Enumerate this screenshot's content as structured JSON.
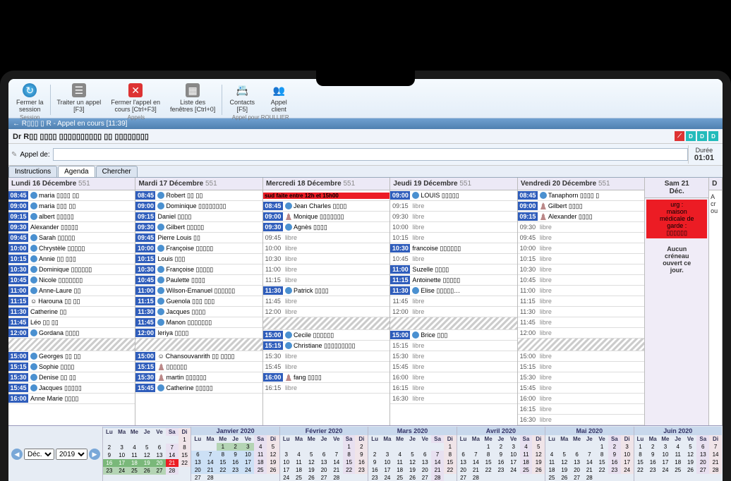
{
  "ribbon": {
    "close_session": "Fermer la\nsession",
    "session_group": "Session",
    "handle_call": "Traiter un appel\n[F3]",
    "close_call": "Fermer l'appel en\ncours [Ctrl+F3]",
    "window_list": "Liste des\nfenêtres [Ctrl+0]",
    "calls_group": "Appels",
    "contacts": "Contacts\n[F5]",
    "client_call": "Appel\nclient",
    "client_group": "Appel pour ROULLIER"
  },
  "titlebar": "← R▯▯▯ ▯ R - Appel en cours [11:39]",
  "context_name": "Dr R▯▯ ▯▯▯▯ ▯▯▯▯▯▯▯▯▯▯ ▯▯ ▯▯▯▯▯▯▯▯",
  "search": {
    "label": "Appel de:",
    "placeholder": ""
  },
  "duree": {
    "label": "Durée",
    "value": "01:01"
  },
  "tabs": {
    "instructions": "Instructions",
    "agenda": "Agenda",
    "chercher": "Chercher"
  },
  "days": [
    {
      "title": "Lundi 16 Décembre",
      "count": "551",
      "slots": [
        {
          "time": "08:45",
          "kind": "appt",
          "icon": "globe",
          "label": "maria ▯▯▯▯ ▯▯"
        },
        {
          "time": "09:00",
          "kind": "appt",
          "icon": "globe",
          "label": "maria ▯▯▯ ▯▯"
        },
        {
          "time": "09:15",
          "kind": "appt",
          "icon": "globe",
          "label": "albert ▯▯▯▯▯"
        },
        {
          "time": "09:30",
          "kind": "appt",
          "icon": "",
          "label": "Alexander ▯▯▯▯▯"
        },
        {
          "time": "09:45",
          "kind": "appt",
          "icon": "globe",
          "label": "Sarah ▯▯▯▯▯"
        },
        {
          "time": "10:00",
          "kind": "appt",
          "icon": "globe",
          "label": "Chrystèle ▯▯▯▯▯"
        },
        {
          "time": "10:15",
          "kind": "appt",
          "icon": "globe",
          "label": "Annie ▯▯ ▯▯▯"
        },
        {
          "time": "10:30",
          "kind": "appt",
          "icon": "globe",
          "label": "Dominique ▯▯▯▯▯▯"
        },
        {
          "time": "10:45",
          "kind": "appt",
          "icon": "globe",
          "label": "Nicole ▯▯▯▯▯▯▯"
        },
        {
          "time": "11:00",
          "kind": "appt",
          "icon": "globe",
          "label": "Anne-Laure ▯▯"
        },
        {
          "time": "11:15",
          "kind": "appt",
          "icon": "emoji",
          "label": "Harouna ▯▯ ▯▯"
        },
        {
          "time": "11:30",
          "kind": "appt",
          "icon": "",
          "label": "Catherine ▯▯"
        },
        {
          "time": "11:45",
          "kind": "appt",
          "icon": "",
          "label": "Léo ▯▯ ▯▯"
        },
        {
          "time": "12:00",
          "kind": "appt",
          "icon": "globe",
          "label": "Gordana ▯▯▯▯"
        }
      ],
      "afternoon": [
        {
          "time": "15:00",
          "kind": "appt",
          "icon": "globe",
          "label": "Georges ▯▯ ▯▯"
        },
        {
          "time": "15:15",
          "kind": "appt",
          "icon": "globe",
          "label": "Sophie ▯▯▯▯"
        },
        {
          "time": "15:30",
          "kind": "appt",
          "icon": "globe",
          "label": "Denise ▯▯ ▯▯"
        },
        {
          "time": "15:45",
          "kind": "appt",
          "icon": "globe",
          "label": "Jacques ▯▯▯▯▯"
        },
        {
          "time": "16:00",
          "kind": "appt",
          "icon": "",
          "label": "Anne Marie ▯▯▯▯"
        }
      ]
    },
    {
      "title": "Mardi 17 Décembre",
      "count": "551",
      "slots": [
        {
          "time": "08:45",
          "kind": "appt",
          "icon": "globe",
          "label": "Robert ▯▯ ▯▯"
        },
        {
          "time": "09:00",
          "kind": "appt",
          "icon": "globe",
          "label": "Dominique ▯▯▯▯▯▯▯▯"
        },
        {
          "time": "09:15",
          "kind": "appt",
          "icon": "",
          "label": "Daniel ▯▯▯▯"
        },
        {
          "time": "09:30",
          "kind": "appt",
          "icon": "globe",
          "label": "Gilbert ▯▯▯▯▯"
        },
        {
          "time": "09:45",
          "kind": "appt",
          "icon": "",
          "label": "Pierre Louis ▯▯"
        },
        {
          "time": "10:00",
          "kind": "appt",
          "icon": "globe",
          "label": "Françoise ▯▯▯▯▯"
        },
        {
          "time": "10:15",
          "kind": "appt",
          "icon": "",
          "label": "Louis ▯▯▯"
        },
        {
          "time": "10:30",
          "kind": "appt",
          "icon": "globe",
          "label": "Françoise ▯▯▯▯▯"
        },
        {
          "time": "10:45",
          "kind": "appt",
          "icon": "globe",
          "label": "Paulette ▯▯▯▯"
        },
        {
          "time": "11:00",
          "kind": "appt",
          "icon": "globe",
          "label": "Wilson-Emanuel ▯▯▯▯▯▯"
        },
        {
          "time": "11:15",
          "kind": "appt",
          "icon": "globe",
          "label": "Guenola ▯▯▯ ▯▯▯"
        },
        {
          "time": "11:30",
          "kind": "appt",
          "icon": "globe",
          "label": "Jacques ▯▯▯▯"
        },
        {
          "time": "11:45",
          "kind": "appt",
          "icon": "globe",
          "label": "Manon ▯▯▯▯▯▯▯"
        },
        {
          "time": "12:00",
          "kind": "appt",
          "icon": "",
          "label": "leriya ▯▯▯▯"
        }
      ],
      "afternoon": [
        {
          "time": "15:00",
          "kind": "appt",
          "icon": "emoji",
          "label": "Chansouvanrith ▯▯ ▯▯▯▯"
        },
        {
          "time": "15:15",
          "kind": "appt",
          "icon": "person",
          "label": "▯▯▯▯▯▯"
        },
        {
          "time": "15:30",
          "kind": "appt",
          "icon": "person",
          "label": "martin ▯▯▯▯▯▯"
        },
        {
          "time": "15:45",
          "kind": "appt",
          "icon": "globe",
          "label": "Catherine ▯▯▯▯▯"
        }
      ]
    },
    {
      "title": "Mercredi 18 Décembre",
      "count": "551",
      "slots": [
        {
          "time": "",
          "kind": "blocked",
          "label": "sud faite entre 12h et 15h00"
        },
        {
          "time": "08:45",
          "kind": "appt",
          "icon": "globe",
          "label": "Jean Charles ▯▯▯▯"
        },
        {
          "time": "09:00",
          "kind": "appt",
          "icon": "person",
          "label": "Monique ▯▯▯▯▯▯▯"
        },
        {
          "time": "09:30",
          "kind": "appt",
          "icon": "globe",
          "label": "Agnès ▯▯▯▯"
        },
        {
          "time": "09:45",
          "kind": "free",
          "label": "libre"
        },
        {
          "time": "10:00",
          "kind": "free",
          "label": "libre"
        },
        {
          "time": "10:30",
          "kind": "free",
          "label": "libre"
        },
        {
          "time": "11:00",
          "kind": "free",
          "label": "libre"
        },
        {
          "time": "11:15",
          "kind": "free",
          "label": "libre"
        },
        {
          "time": "11:30",
          "kind": "appt",
          "icon": "globe",
          "label": "Patrick ▯▯▯▯"
        },
        {
          "time": "11:45",
          "kind": "free",
          "label": "libre"
        },
        {
          "time": "12:00",
          "kind": "free",
          "label": "libre"
        }
      ],
      "afternoon": [
        {
          "time": "15:00",
          "kind": "appt",
          "icon": "globe",
          "label": "Cecile ▯▯▯▯▯▯"
        },
        {
          "time": "15:15",
          "kind": "appt",
          "icon": "globe",
          "label": "Christiane ▯▯▯▯▯▯▯▯▯"
        },
        {
          "time": "15:30",
          "kind": "free",
          "label": "libre"
        },
        {
          "time": "15:45",
          "kind": "free",
          "label": "libre"
        },
        {
          "time": "16:00",
          "kind": "appt",
          "icon": "person",
          "label": "fang ▯▯▯▯"
        },
        {
          "time": "16:15",
          "kind": "free",
          "label": "libre"
        }
      ]
    },
    {
      "title": "Jeudi 19 Décembre",
      "count": "551",
      "slots": [
        {
          "time": "09:00",
          "kind": "appt",
          "icon": "globe",
          "label": "LOUIS ▯▯▯▯▯"
        },
        {
          "time": "09:15",
          "kind": "free",
          "label": "libre"
        },
        {
          "time": "09:30",
          "kind": "free",
          "label": "libre"
        },
        {
          "time": "10:00",
          "kind": "free",
          "label": "libre"
        },
        {
          "time": "10:15",
          "kind": "free",
          "label": "libre"
        },
        {
          "time": "10:30",
          "kind": "appt",
          "icon": "",
          "label": "francoise ▯▯▯▯▯▯"
        },
        {
          "time": "10:45",
          "kind": "free",
          "label": "libre"
        },
        {
          "time": "11:00",
          "kind": "appt",
          "icon": "",
          "label": "Suzelle ▯▯▯▯"
        },
        {
          "time": "11:15",
          "kind": "appt",
          "icon": "",
          "label": "Antoinette ▯▯▯▯▯"
        },
        {
          "time": "11:30",
          "kind": "appt",
          "icon": "globe",
          "label": "Elise ▯▯▯▯▯…"
        },
        {
          "time": "11:45",
          "kind": "free",
          "label": "libre"
        },
        {
          "time": "12:00",
          "kind": "free",
          "label": "libre"
        }
      ],
      "afternoon": [
        {
          "time": "15:00",
          "kind": "appt",
          "icon": "globe",
          "label": "Brice ▯▯▯"
        },
        {
          "time": "15:15",
          "kind": "free",
          "label": "libre"
        },
        {
          "time": "15:30",
          "kind": "free",
          "label": "libre"
        },
        {
          "time": "15:45",
          "kind": "free",
          "label": "libre"
        },
        {
          "time": "16:00",
          "kind": "free",
          "label": "libre"
        },
        {
          "time": "16:15",
          "kind": "free",
          "label": "libre"
        },
        {
          "time": "16:30",
          "kind": "free",
          "label": "libre"
        }
      ]
    },
    {
      "title": "Vendredi 20 Décembre",
      "count": "551",
      "slots": [
        {
          "time": "08:45",
          "kind": "appt",
          "icon": "globe",
          "label": "Tanaphorn ▯▯▯▯ ▯"
        },
        {
          "time": "09:00",
          "kind": "appt",
          "icon": "person",
          "label": "Gilbert ▯▯▯▯"
        },
        {
          "time": "09:15",
          "kind": "appt",
          "icon": "person",
          "label": "Alexander ▯▯▯▯"
        },
        {
          "time": "09:30",
          "kind": "free",
          "label": "libre"
        },
        {
          "time": "09:45",
          "kind": "free",
          "label": "libre"
        },
        {
          "time": "10:00",
          "kind": "free",
          "label": "libre"
        },
        {
          "time": "10:15",
          "kind": "free",
          "label": "libre"
        },
        {
          "time": "10:30",
          "kind": "free",
          "label": "libre"
        },
        {
          "time": "10:45",
          "kind": "free",
          "label": "libre"
        },
        {
          "time": "11:00",
          "kind": "free",
          "label": "libre"
        },
        {
          "time": "11:15",
          "kind": "free",
          "label": "libre"
        },
        {
          "time": "11:30",
          "kind": "free",
          "label": "libre"
        },
        {
          "time": "11:45",
          "kind": "free",
          "label": "libre"
        },
        {
          "time": "12:00",
          "kind": "free",
          "label": "libre"
        }
      ],
      "afternoon": [
        {
          "time": "15:00",
          "kind": "free",
          "label": "libre"
        },
        {
          "time": "15:15",
          "kind": "free",
          "label": "libre"
        },
        {
          "time": "15:30",
          "kind": "free",
          "label": "libre"
        },
        {
          "time": "15:45",
          "kind": "free",
          "label": "libre"
        },
        {
          "time": "16:00",
          "kind": "free",
          "label": "libre"
        },
        {
          "time": "16:15",
          "kind": "free",
          "label": "libre"
        },
        {
          "time": "16:30",
          "kind": "free",
          "label": "libre"
        }
      ]
    }
  ],
  "saturday": {
    "title": "Sam 21\nDéc.",
    "urg": "urg :\nmaison\nmédicale de\ngarde :\n▯▯▯▯▯▯",
    "no_slot": "Aucun\ncréneau\nouvert ce\njour."
  },
  "cal": {
    "month_sel": "Déc.",
    "year_sel": "2019",
    "prev_arrow": "◀",
    "next_arrow": "▶",
    "dow": [
      "Lu",
      "Ma",
      "Me",
      "Je",
      "Ve",
      "Sa",
      "Di"
    ],
    "months": [
      {
        "title": "",
        "month": 12,
        "year": 2019,
        "highlight": true
      },
      {
        "title": "Janvier 2020",
        "month": 1,
        "year": 2020
      },
      {
        "title": "Février 2020",
        "month": 2,
        "year": 2020
      },
      {
        "title": "Mars 2020",
        "month": 3,
        "year": 2020
      },
      {
        "title": "Avril 2020",
        "month": 4,
        "year": 2020
      },
      {
        "title": "Mai 2020",
        "month": 5,
        "year": 2020
      },
      {
        "title": "Juin 2020",
        "month": 6,
        "year": 2020
      }
    ]
  }
}
